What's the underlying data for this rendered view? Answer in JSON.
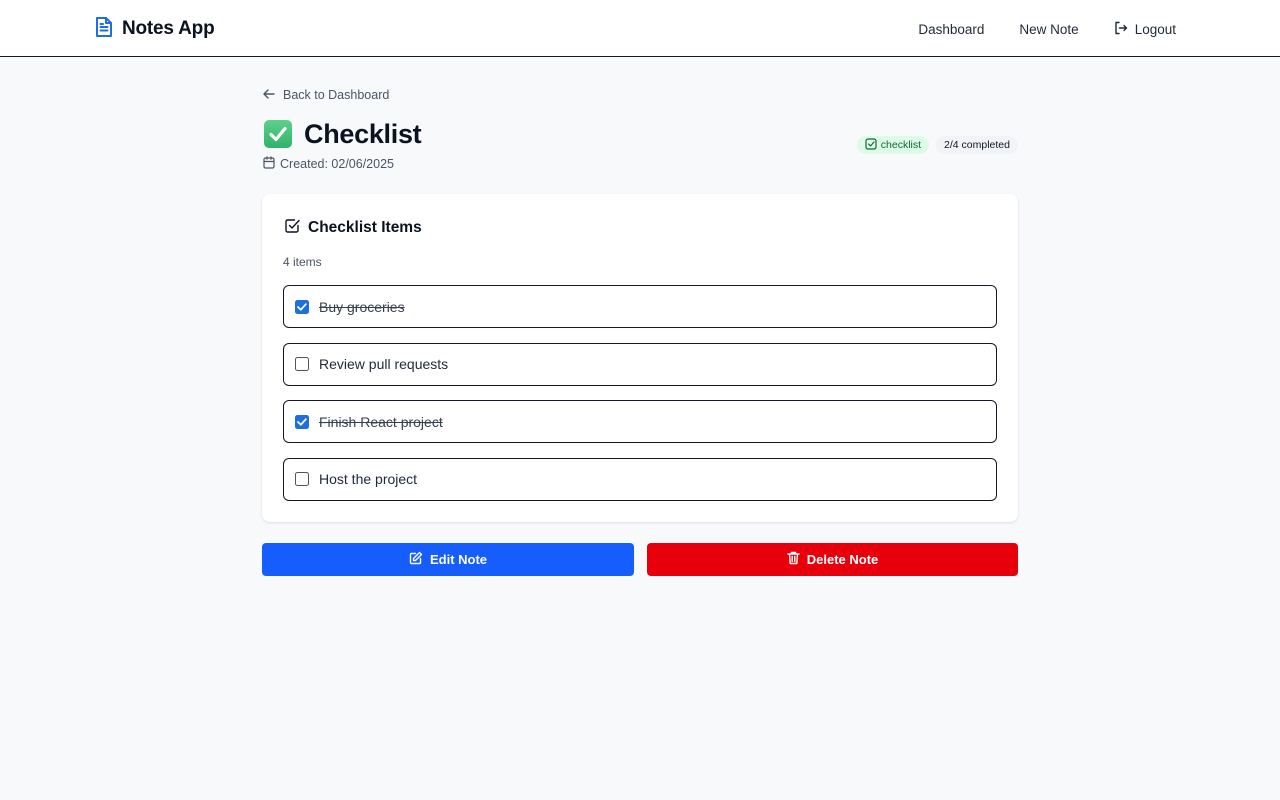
{
  "nav": {
    "brand": "Notes App",
    "links": [
      "Dashboard",
      "New Note"
    ],
    "logout": "Logout"
  },
  "page": {
    "back_label": "Back to Dashboard",
    "title": "Checklist",
    "created": "Created: 02/06/2025",
    "type_badge": "checklist",
    "progress_badge": "2/4 completed"
  },
  "card": {
    "title": "Checklist Items",
    "item_count": "4 items",
    "items": [
      {
        "label": "Buy groceries",
        "checked": true
      },
      {
        "label": "Review pull requests",
        "checked": false
      },
      {
        "label": "Finish React project",
        "checked": true
      },
      {
        "label": "Host the project",
        "checked": false
      }
    ]
  },
  "actions": {
    "edit_label": "Edit Note",
    "delete_label": "Delete Note"
  },
  "colors": {
    "primary": "#155dfc",
    "danger": "#e7000b",
    "checkbox": "#1d6fe0",
    "badge_green_bg": "#dcfce7"
  },
  "icons": {
    "brand": "file-text-icon",
    "logout": "logout-icon",
    "back": "arrow-left-icon",
    "title": "check-mark-button-emoji",
    "calendar": "calendar-icon",
    "badge": "square-check-icon",
    "card": "square-check-icon",
    "edit": "edit-icon",
    "delete": "trash-icon"
  }
}
